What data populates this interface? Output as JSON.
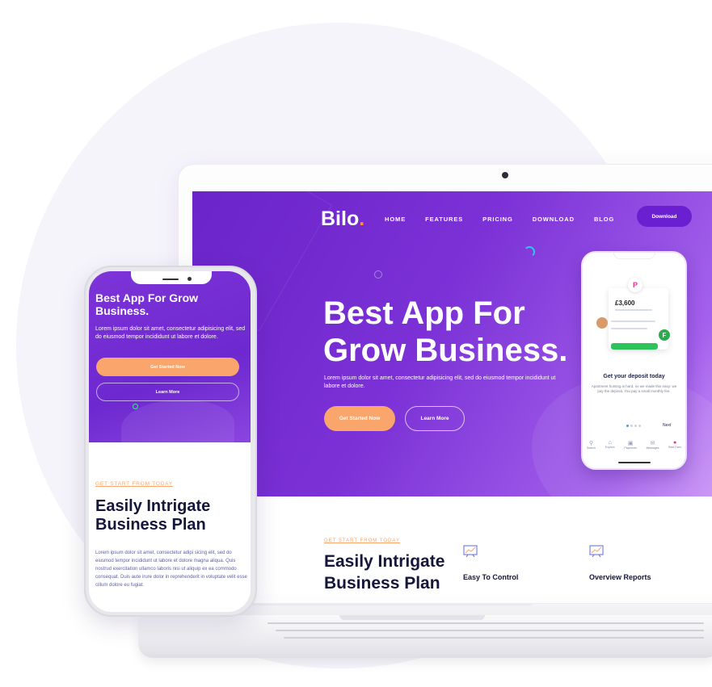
{
  "colors": {
    "hero_gradient_start": "#6a24c9",
    "hero_gradient_end": "#c891f5",
    "accent_orange": "#f9a56c",
    "heading_dark": "#14163a",
    "download_button": "#6a1fd1",
    "success_green": "#2ec35a"
  },
  "laptop": {
    "logo": "Bilo",
    "logo_dot": ".",
    "nav": [
      "HOME",
      "FEATURES",
      "PRICING",
      "DOWNLOAD",
      "BLOG"
    ],
    "download_label": "Download",
    "hero": {
      "title": "Best App For Grow Business.",
      "description": "Lorem ipsum dolor sit amet, consectetur adipisicing elit, sed do eiusmod tempor incididunt ut labore et dolore.",
      "primary_button": "Get Started Now",
      "secondary_button": "Learn More"
    },
    "phone_mockup": {
      "amount": "£3,600",
      "f_badge": "F",
      "heading": "Get your deposit today",
      "text": "Apartment hunting is hard, so we made this easy: we pay the deposit. You pay a small monthly fee.",
      "next_label": "Next",
      "tabs": [
        {
          "label": "Search",
          "icon": "search-icon"
        },
        {
          "label": "Explore",
          "icon": "home-icon"
        },
        {
          "label": "Payments",
          "icon": "card-icon"
        },
        {
          "label": "Messages",
          "icon": "mail-icon"
        },
        {
          "label": "Best Fans",
          "icon": "people-icon"
        }
      ]
    },
    "features": {
      "eyebrow": "GET START FROM TODAY",
      "title": "Easily Intrigate Business Plan",
      "items": [
        {
          "label": "Easy To Control",
          "icon": "chart-board-icon"
        },
        {
          "label": "Overview Reports",
          "icon": "chart-board-icon"
        }
      ]
    }
  },
  "phone": {
    "hero": {
      "title": "Best App For Grow Business.",
      "description": "Lorem ipsum dolor sit amet, consectetur adipisicing elit, sed do eiusmod tempor incididunt ut labore et dolore.",
      "primary_button": "Get Started Now",
      "secondary_button": "Learn More"
    },
    "section": {
      "eyebrow": "GET START FROM TODAY",
      "title": "Easily Intrigate Business Plan",
      "body": "Lorem ipsum dolor sit amet, consectetur adipi sicing elit, sed do eiusmod tempor incididunt ut labore et dolore magna aliqua. Quis nostrud exercitation ullamco laboris nisi ut aliquip ex ea commodo consequat. Duis aute irure dolor in reprehenderit in voluptate velit esse cillum dolore eu fugiat."
    }
  }
}
